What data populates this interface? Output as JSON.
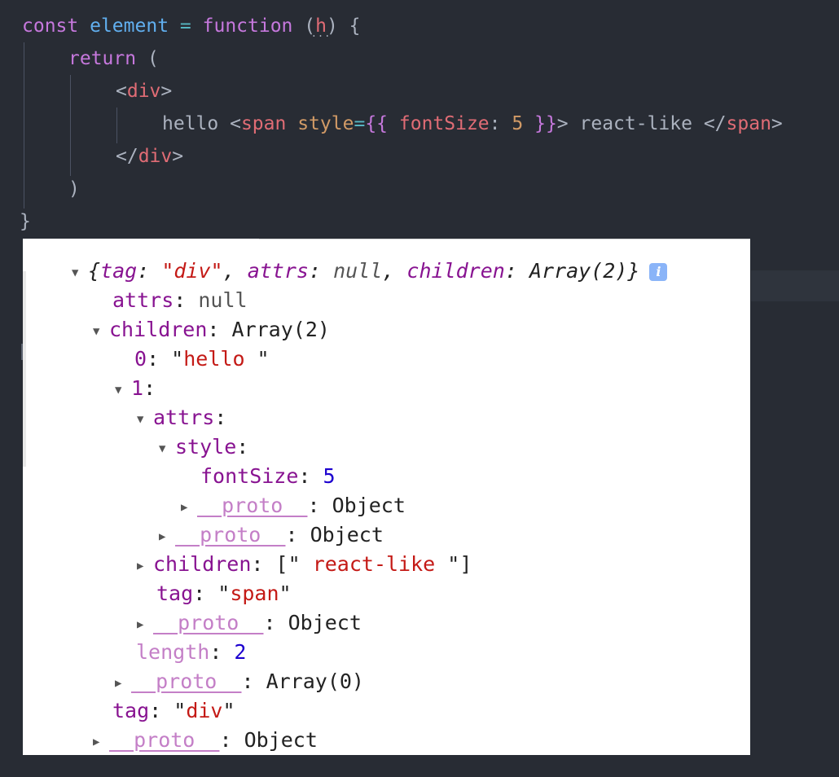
{
  "code": {
    "line1": {
      "kw_const": "const",
      "name": "element",
      "eq": "=",
      "kw_function": "function",
      "paren_open": "(",
      "param": "h",
      "paren_close_brace": ") {",
      "param_hint": "..."
    },
    "line2": {
      "kw_return": "return",
      "paren": "("
    },
    "line3": {
      "lt": "<",
      "tag": "div",
      "gt": ">"
    },
    "line4": {
      "text": "hello ",
      "lt": "<",
      "tag_open": "span",
      "attr": "style",
      "eq": "=",
      "brace_open": "{{",
      "prop": "fontSize",
      "colon": ":",
      "num": "5",
      "brace_close": "}}",
      "gt": ">",
      "text2": " react-like ",
      "lt_slash": "</",
      "tag_close": "span",
      "gt2": ">"
    },
    "line5": {
      "lt_slash": "</",
      "tag": "div",
      "gt": ">"
    },
    "line6": {
      "paren": ")"
    },
    "line7": {
      "brace": "}"
    }
  },
  "console": {
    "summary": {
      "open": "{",
      "k1": "tag",
      "v1": "\"div\"",
      "k2": "attrs",
      "v2": "null",
      "k3": "children",
      "v3": "Array(2)",
      "close": "}",
      "info_icon": "info-icon",
      "info_glyph": "i"
    },
    "attrs": {
      "key": "attrs",
      "value": "null"
    },
    "children": {
      "key": "children",
      "value": "Array(2)"
    },
    "child0": {
      "key": "0",
      "value": "hello "
    },
    "child1": {
      "key": "1"
    },
    "child1_attrs": {
      "key": "attrs"
    },
    "style": {
      "key": "style"
    },
    "font_size": {
      "key": "fontSize",
      "value": "5"
    },
    "style_proto": {
      "key": "__proto__",
      "value": "Object"
    },
    "attrs_proto": {
      "key": "__proto__",
      "value": "Object"
    },
    "child1_children": {
      "key": "children",
      "value": " react-like "
    },
    "child1_tag": {
      "key": "tag",
      "value": "span"
    },
    "child1_proto": {
      "key": "__proto__",
      "value": "Object"
    },
    "length": {
      "key": "length",
      "value": "2"
    },
    "array_proto": {
      "key": "__proto__",
      "value": "Array(0)"
    },
    "tag": {
      "key": "tag",
      "value": "div"
    },
    "root_proto": {
      "key": "__proto__",
      "value": "Object"
    },
    "expanded_glyph": "▼",
    "collapsed_glyph": "▶"
  }
}
